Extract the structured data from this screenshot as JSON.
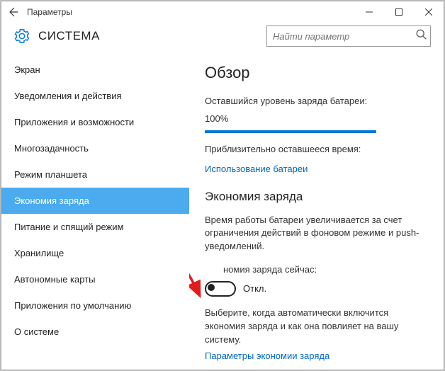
{
  "window": {
    "title": "Параметры"
  },
  "header": {
    "title": "СИСТЕМА",
    "search_placeholder": "Найти параметр"
  },
  "sidebar": {
    "items": [
      {
        "label": "Экран"
      },
      {
        "label": "Уведомления и действия"
      },
      {
        "label": "Приложения и возможности"
      },
      {
        "label": "Многозадачность"
      },
      {
        "label": "Режим планшета"
      },
      {
        "label": "Экономия заряда",
        "selected": true
      },
      {
        "label": "Питание и спящий режим"
      },
      {
        "label": "Хранилище"
      },
      {
        "label": "Автономные карты"
      },
      {
        "label": "Приложения по умолчанию"
      },
      {
        "label": "О системе"
      }
    ]
  },
  "overview": {
    "heading": "Обзор",
    "battery_label": "Оставшийся уровень заряда батареи:",
    "battery_value": "100%",
    "time_label": "Приблизительно оставшееся время:",
    "usage_link": "Использование батареи"
  },
  "saver": {
    "heading": "Экономия заряда",
    "desc": "Время работы батареи увеличивается за счет ограничения действий в фоновом режиме и push-уведомлений.",
    "now_label_full": "Экономия заряда сейчас:",
    "now_label_cut": "номия заряда сейчас:",
    "toggle_state": "Откл.",
    "auto_desc": "Выберите, когда автоматически включится экономия заряда и как она повлияет на вашу систему.",
    "settings_link": "Параметры экономии заряда"
  },
  "chart_data": null
}
